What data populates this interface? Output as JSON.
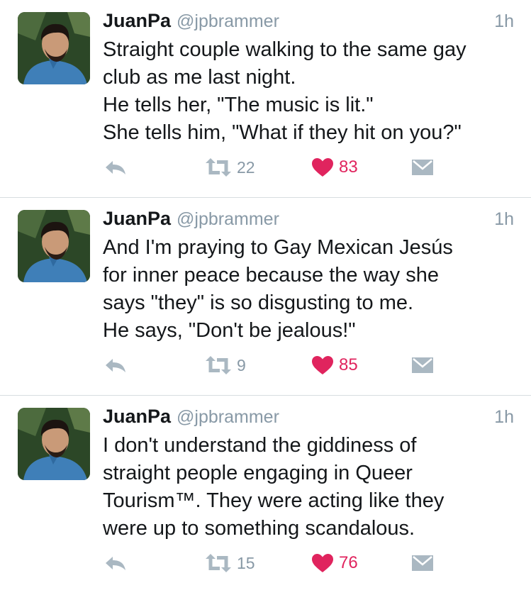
{
  "colors": {
    "name": "#14171a",
    "secondary": "#8899a6",
    "like": "#e0245e",
    "action_icon": "#aab8c2",
    "divider": "#d8dde0"
  },
  "icons": {
    "reply": "reply-arrow-icon",
    "retweet": "retweet-icon",
    "like": "heart-icon",
    "dm": "direct-message-envelope-icon"
  },
  "tweets": [
    {
      "name": "JuanPa",
      "handle": "@jpbrammer",
      "time": "1h",
      "lines": [
        "Straight couple walking to the same gay",
        "club as me last night.",
        "He tells her, \"The music is lit.\"",
        "She tells him, \"What if they hit on you?\""
      ],
      "retweets": "22",
      "likes": "83"
    },
    {
      "name": "JuanPa",
      "handle": "@jpbrammer",
      "time": "1h",
      "lines": [
        "And I'm praying to Gay Mexican Jesús",
        "for inner peace because the way she",
        "says \"they\" is so disgusting to me.",
        "He says, \"Don't be jealous!\""
      ],
      "retweets": "9",
      "likes": "85"
    },
    {
      "name": "JuanPa",
      "handle": "@jpbrammer",
      "time": "1h",
      "lines": [
        "I don't understand the giddiness of",
        "straight people engaging in Queer",
        "Tourism™. They were acting like they",
        "were up to something scandalous."
      ],
      "retweets": "15",
      "likes": "76"
    }
  ]
}
